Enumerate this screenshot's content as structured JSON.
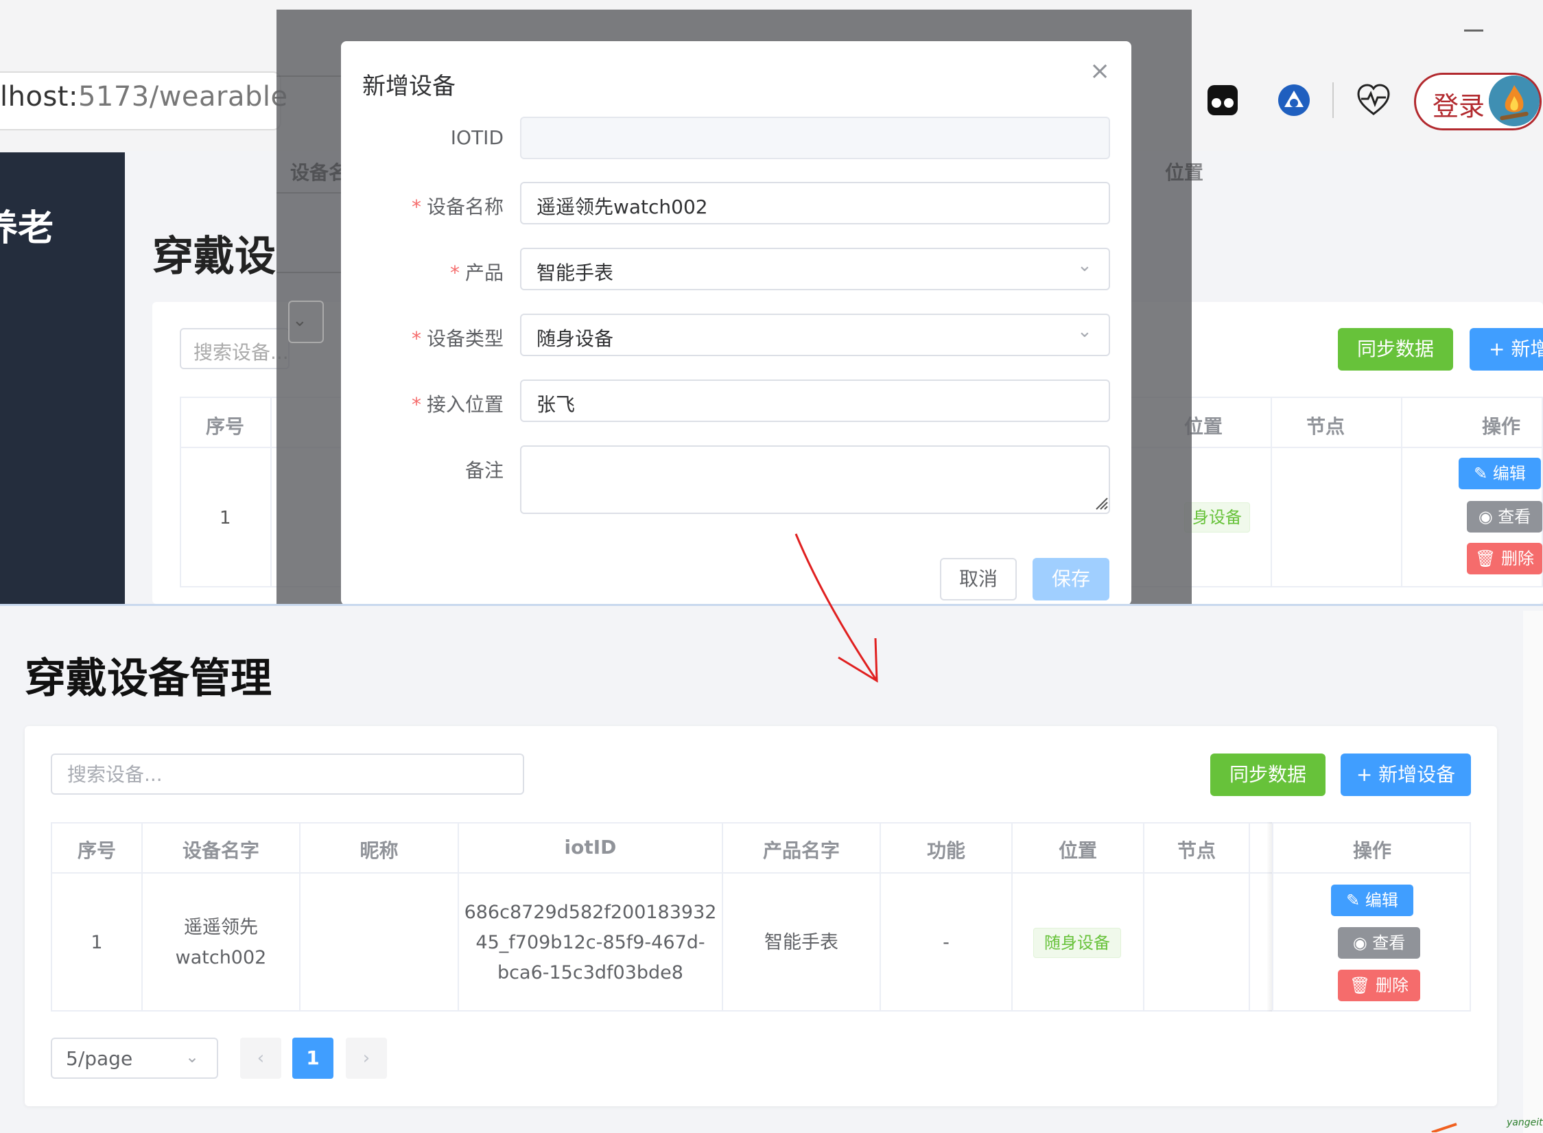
{
  "browser": {
    "url_prefix": "lhost:",
    "url_rest": "5173/wearable",
    "login_label": "登录",
    "extensions": [
      "dark-mode-extension-icon",
      "bird-extension-icon",
      "heartbeat-extension-icon"
    ]
  },
  "background": {
    "sidebar_text": "养老",
    "page_title": "穿戴设",
    "search_placeholder": "搜索设备...",
    "sync_label": "同步数据",
    "add_label": "+ 新增",
    "col_seq": "序号",
    "col_name_partial": "设备名",
    "col_pos_partial": "位置",
    "col_loc": "位置",
    "col_node": "节点",
    "col_ops": "操作",
    "row_seq": "1",
    "tag": "身设备",
    "edit_label": "编辑",
    "view_label": "查看",
    "delete_label": "删除"
  },
  "dialog": {
    "title": "新增设备",
    "close": "×",
    "fields": {
      "iotid": {
        "label": "IOTID",
        "value": ""
      },
      "name": {
        "label": "设备名称",
        "value": "遥遥领先watch002",
        "required": "*"
      },
      "product": {
        "label": "产品",
        "value": "智能手表",
        "required": "*"
      },
      "type": {
        "label": "设备类型",
        "value": "随身设备",
        "required": "*"
      },
      "location": {
        "label": "接入位置",
        "value": "张飞",
        "required": "*"
      },
      "note": {
        "label": "备注",
        "value": ""
      }
    },
    "cancel_label": "取消",
    "save_label": "保存"
  },
  "page": {
    "title": "穿戴设备管理",
    "search_placeholder": "搜索设备...",
    "sync_label": "同步数据",
    "add_label": "+ 新增设备",
    "columns": [
      "序号",
      "设备名字",
      "昵称",
      "iotID",
      "产品名字",
      "功能",
      "位置",
      "节点",
      "操作"
    ],
    "rows": [
      {
        "seq": "1",
        "name_line1": "遥遥领先",
        "name_line2": "watch002",
        "nickname": "",
        "iotid_line1": "686c8729d582f200183932",
        "iotid_line2": "45_f709b12c-85f9-467d-",
        "iotid_line3": "bca6-15c3df03bde8",
        "product": "智能手表",
        "function": "-",
        "location": "随身设备",
        "node": "",
        "edit_label": "编辑",
        "view_label": "查看",
        "delete_label": "删除"
      }
    ],
    "pagination": {
      "page_size": "5/page",
      "current_page": "1",
      "prev": "‹",
      "next": "›"
    }
  },
  "watermark": "yangeit",
  "colors": {
    "primary": "#409eff",
    "success": "#67c23a",
    "danger": "#f56c6c",
    "info": "#909399",
    "sidebar": "#242d3d",
    "annotation_arrow": "#e02020"
  }
}
